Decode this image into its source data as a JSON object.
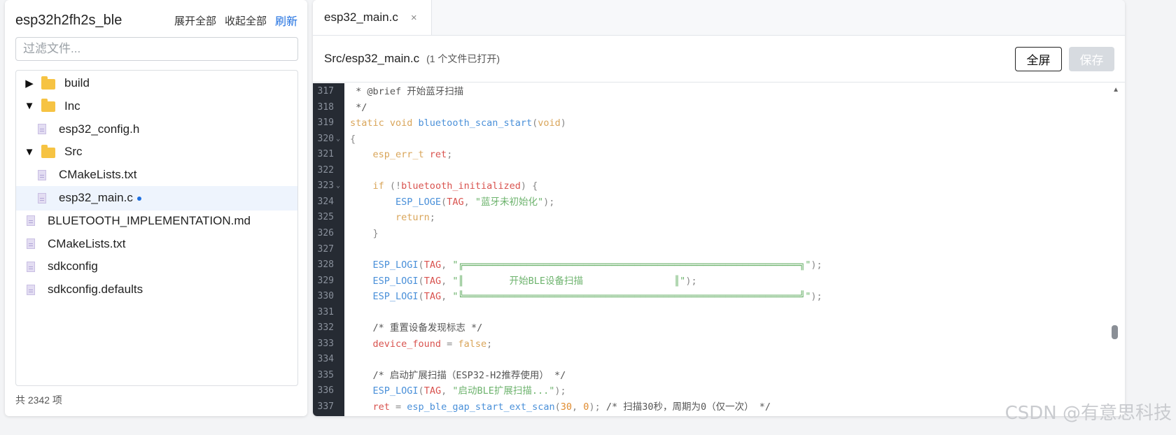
{
  "sidebar": {
    "project_title": "esp32h2fh2s_ble",
    "expand_all": "展开全部",
    "collapse_all": "收起全部",
    "refresh": "刷新",
    "filter_placeholder": "过滤文件...",
    "items": [
      {
        "label": "build",
        "type": "folder",
        "state": "collapsed",
        "arrow": "▶"
      },
      {
        "label": "Inc",
        "type": "folder",
        "state": "expanded",
        "arrow": "▼"
      },
      {
        "label": "esp32_config.h",
        "type": "file"
      },
      {
        "label": "Src",
        "type": "folder",
        "state": "expanded",
        "arrow": "▼"
      },
      {
        "label": "CMakeLists.txt",
        "type": "file"
      },
      {
        "label": "esp32_main.c",
        "type": "file",
        "selected": true,
        "modified": true
      },
      {
        "label": "BLUETOOTH_IMPLEMENTATION.md",
        "type": "file"
      },
      {
        "label": "CMakeLists.txt",
        "type": "file"
      },
      {
        "label": "sdkconfig",
        "type": "file"
      },
      {
        "label": "sdkconfig.defaults",
        "type": "file"
      }
    ],
    "item_count": "共 2342 项"
  },
  "editor": {
    "tab_label": "esp32_main.c",
    "tab_close": "×",
    "file_path": "Src/esp32_main.c",
    "open_info": "(1 个文件已打开)",
    "fullscreen_label": "全屏",
    "save_label": "保存",
    "lines": [
      {
        "n": "317",
        "tokens": [
          [
            "c-comment",
            " * @brief 开始蓝牙扫描"
          ]
        ]
      },
      {
        "n": "318",
        "tokens": [
          [
            "c-comment",
            " */"
          ]
        ]
      },
      {
        "n": "319",
        "tokens": [
          [
            "c-kw",
            "static void "
          ],
          [
            "c-fn",
            "bluetooth_scan_start"
          ],
          [
            "c-punc",
            "("
          ],
          [
            "c-kw",
            "void"
          ],
          [
            "c-punc",
            ")"
          ]
        ]
      },
      {
        "n": "320",
        "fold": true,
        "tokens": [
          [
            "c-punc",
            "{"
          ]
        ]
      },
      {
        "n": "321",
        "tokens": [
          [
            "c-kw",
            "    esp_err_t "
          ],
          [
            "c-var",
            "ret"
          ],
          [
            "c-punc",
            ";"
          ]
        ]
      },
      {
        "n": "322",
        "tokens": []
      },
      {
        "n": "323",
        "fold": true,
        "tokens": [
          [
            "c-kw",
            "    if "
          ],
          [
            "c-punc",
            "(!"
          ],
          [
            "c-var",
            "bluetooth_initialized"
          ],
          [
            "c-punc",
            ") {"
          ]
        ]
      },
      {
        "n": "324",
        "tokens": [
          [
            "c-macro",
            "        ESP_LOGE"
          ],
          [
            "c-punc",
            "("
          ],
          [
            "c-var",
            "TAG"
          ],
          [
            "c-punc",
            ", "
          ],
          [
            "c-str",
            "\"蓝牙未初始化\""
          ],
          [
            "c-punc",
            ");"
          ]
        ]
      },
      {
        "n": "325",
        "tokens": [
          [
            "c-kw",
            "        return"
          ],
          [
            "c-punc",
            ";"
          ]
        ]
      },
      {
        "n": "326",
        "tokens": [
          [
            "c-punc",
            "    }"
          ]
        ]
      },
      {
        "n": "327",
        "tokens": []
      },
      {
        "n": "328",
        "tokens": [
          [
            "c-macro",
            "    ESP_LOGI"
          ],
          [
            "c-punc",
            "("
          ],
          [
            "c-var",
            "TAG"
          ],
          [
            "c-punc",
            ", "
          ],
          [
            "c-str",
            "\"╔═══════════════════════════════════════════════════════════╗\""
          ],
          [
            "c-punc",
            ");"
          ]
        ]
      },
      {
        "n": "329",
        "tokens": [
          [
            "c-macro",
            "    ESP_LOGI"
          ],
          [
            "c-punc",
            "("
          ],
          [
            "c-var",
            "TAG"
          ],
          [
            "c-punc",
            ", "
          ],
          [
            "c-str",
            "\"║        开始BLE设备扫描                ║\""
          ],
          [
            "c-punc",
            ");"
          ]
        ]
      },
      {
        "n": "330",
        "tokens": [
          [
            "c-macro",
            "    ESP_LOGI"
          ],
          [
            "c-punc",
            "("
          ],
          [
            "c-var",
            "TAG"
          ],
          [
            "c-punc",
            ", "
          ],
          [
            "c-str",
            "\"╚═══════════════════════════════════════════════════════════╝\""
          ],
          [
            "c-punc",
            ");"
          ]
        ]
      },
      {
        "n": "331",
        "tokens": []
      },
      {
        "n": "332",
        "tokens": [
          [
            "c-comment",
            "    /* 重置设备发现标志 */"
          ]
        ]
      },
      {
        "n": "333",
        "tokens": [
          [
            "c-var",
            "    device_found "
          ],
          [
            "c-punc",
            "= "
          ],
          [
            "c-kw",
            "false"
          ],
          [
            "c-punc",
            ";"
          ]
        ]
      },
      {
        "n": "334",
        "tokens": []
      },
      {
        "n": "335",
        "tokens": [
          [
            "c-comment",
            "    /* 启动扩展扫描（ESP32-H2推荐使用） */"
          ]
        ]
      },
      {
        "n": "336",
        "tokens": [
          [
            "c-macro",
            "    ESP_LOGI"
          ],
          [
            "c-punc",
            "("
          ],
          [
            "c-var",
            "TAG"
          ],
          [
            "c-punc",
            ", "
          ],
          [
            "c-str",
            "\"启动BLE扩展扫描...\""
          ],
          [
            "c-punc",
            ");"
          ]
        ]
      },
      {
        "n": "337",
        "tokens": [
          [
            "c-var",
            "    ret "
          ],
          [
            "c-punc",
            "= "
          ],
          [
            "c-fn",
            "esp_ble_gap_start_ext_scan"
          ],
          [
            "c-punc",
            "("
          ],
          [
            "c-num",
            "30"
          ],
          [
            "c-punc",
            ", "
          ],
          [
            "c-num",
            "0"
          ],
          [
            "c-punc",
            "); "
          ],
          [
            "c-comment",
            "/* 扫描30秒，周期为0（仅一次） */"
          ]
        ]
      }
    ]
  },
  "watermark": "CSDN @有意思科技"
}
